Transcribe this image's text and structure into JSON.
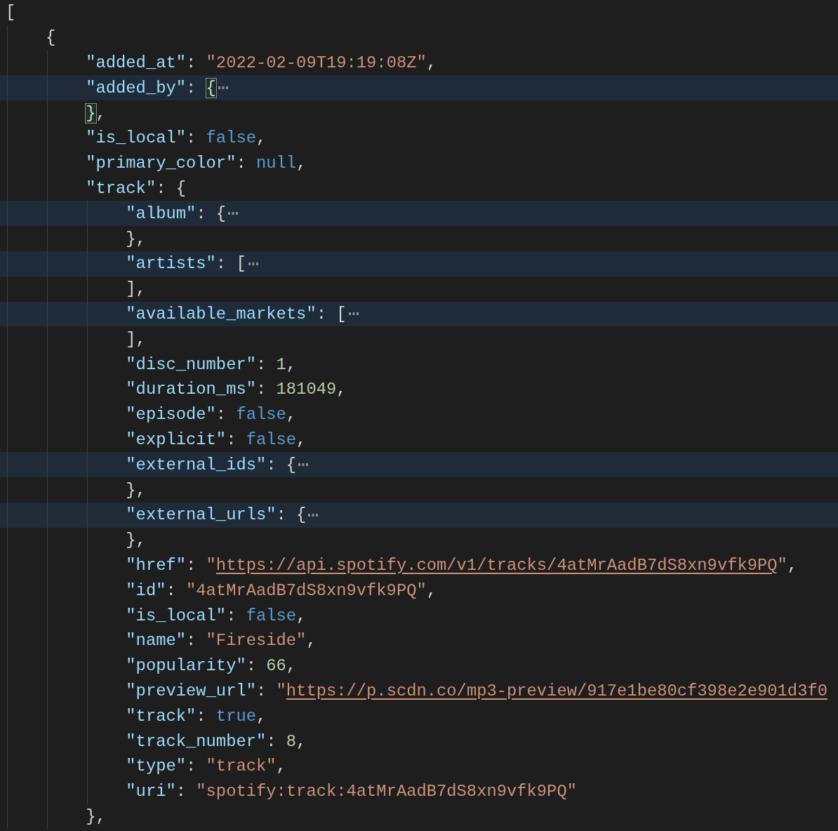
{
  "lines": [
    {
      "folded": false,
      "tokens": [
        {
          "kind": "punct",
          "text": "["
        }
      ],
      "children": [
        {
          "folded": false,
          "tokens": [
            {
              "kind": "punct",
              "text": "{"
            }
          ],
          "children": [
            {
              "folded": false,
              "tokens": [
                {
                  "kind": "key",
                  "text": "\"added_at\""
                },
                {
                  "kind": "punct",
                  "text": ": "
                },
                {
                  "kind": "string",
                  "text": "\"2022-02-09T19:19:08Z\""
                },
                {
                  "kind": "punct",
                  "text": ","
                }
              ]
            },
            {
              "folded": true,
              "tokens": [
                {
                  "kind": "key",
                  "text": "\"added_by\""
                },
                {
                  "kind": "punct",
                  "text": ": "
                },
                {
                  "kind": "match",
                  "text": "{"
                }
              ]
            },
            {
              "folded": false,
              "tokens": [
                {
                  "kind": "match",
                  "text": "}"
                },
                {
                  "kind": "punct",
                  "text": ","
                }
              ]
            },
            {
              "folded": false,
              "tokens": [
                {
                  "kind": "key",
                  "text": "\"is_local\""
                },
                {
                  "kind": "punct",
                  "text": ": "
                },
                {
                  "kind": "keyword",
                  "text": "false"
                },
                {
                  "kind": "punct",
                  "text": ","
                }
              ]
            },
            {
              "folded": false,
              "tokens": [
                {
                  "kind": "key",
                  "text": "\"primary_color\""
                },
                {
                  "kind": "punct",
                  "text": ": "
                },
                {
                  "kind": "keyword",
                  "text": "null"
                },
                {
                  "kind": "punct",
                  "text": ","
                }
              ]
            },
            {
              "folded": false,
              "tokens": [
                {
                  "kind": "key",
                  "text": "\"track\""
                },
                {
                  "kind": "punct",
                  "text": ": {"
                }
              ],
              "children": [
                {
                  "folded": true,
                  "tokens": [
                    {
                      "kind": "key",
                      "text": "\"album\""
                    },
                    {
                      "kind": "punct",
                      "text": ": {"
                    }
                  ]
                },
                {
                  "folded": false,
                  "tokens": [
                    {
                      "kind": "punct",
                      "text": "},"
                    }
                  ]
                },
                {
                  "folded": true,
                  "tokens": [
                    {
                      "kind": "key",
                      "text": "\"artists\""
                    },
                    {
                      "kind": "punct",
                      "text": ": ["
                    }
                  ]
                },
                {
                  "folded": false,
                  "tokens": [
                    {
                      "kind": "punct",
                      "text": "],"
                    }
                  ]
                },
                {
                  "folded": true,
                  "tokens": [
                    {
                      "kind": "key",
                      "text": "\"available_markets\""
                    },
                    {
                      "kind": "punct",
                      "text": ": ["
                    }
                  ]
                },
                {
                  "folded": false,
                  "tokens": [
                    {
                      "kind": "punct",
                      "text": "],"
                    }
                  ]
                },
                {
                  "folded": false,
                  "tokens": [
                    {
                      "kind": "key",
                      "text": "\"disc_number\""
                    },
                    {
                      "kind": "punct",
                      "text": ": "
                    },
                    {
                      "kind": "number",
                      "text": "1"
                    },
                    {
                      "kind": "punct",
                      "text": ","
                    }
                  ]
                },
                {
                  "folded": false,
                  "tokens": [
                    {
                      "kind": "key",
                      "text": "\"duration_ms\""
                    },
                    {
                      "kind": "punct",
                      "text": ": "
                    },
                    {
                      "kind": "number",
                      "text": "181049"
                    },
                    {
                      "kind": "punct",
                      "text": ","
                    }
                  ]
                },
                {
                  "folded": false,
                  "tokens": [
                    {
                      "kind": "key",
                      "text": "\"episode\""
                    },
                    {
                      "kind": "punct",
                      "text": ": "
                    },
                    {
                      "kind": "keyword",
                      "text": "false"
                    },
                    {
                      "kind": "punct",
                      "text": ","
                    }
                  ]
                },
                {
                  "folded": false,
                  "tokens": [
                    {
                      "kind": "key",
                      "text": "\"explicit\""
                    },
                    {
                      "kind": "punct",
                      "text": ": "
                    },
                    {
                      "kind": "keyword",
                      "text": "false"
                    },
                    {
                      "kind": "punct",
                      "text": ","
                    }
                  ]
                },
                {
                  "folded": true,
                  "tokens": [
                    {
                      "kind": "key",
                      "text": "\"external_ids\""
                    },
                    {
                      "kind": "punct",
                      "text": ": {"
                    }
                  ]
                },
                {
                  "folded": false,
                  "tokens": [
                    {
                      "kind": "punct",
                      "text": "},"
                    }
                  ]
                },
                {
                  "folded": true,
                  "tokens": [
                    {
                      "kind": "key",
                      "text": "\"external_urls\""
                    },
                    {
                      "kind": "punct",
                      "text": ": {"
                    }
                  ]
                },
                {
                  "folded": false,
                  "tokens": [
                    {
                      "kind": "punct",
                      "text": "},"
                    }
                  ]
                },
                {
                  "folded": false,
                  "tokens": [
                    {
                      "kind": "key",
                      "text": "\"href\""
                    },
                    {
                      "kind": "punct",
                      "text": ": "
                    },
                    {
                      "kind": "string",
                      "text": "\""
                    },
                    {
                      "kind": "link",
                      "text": "https://api.spotify.com/v1/tracks/4atMrAadB7dS8xn9vfk9PQ"
                    },
                    {
                      "kind": "string",
                      "text": "\""
                    },
                    {
                      "kind": "punct",
                      "text": ","
                    }
                  ]
                },
                {
                  "folded": false,
                  "tokens": [
                    {
                      "kind": "key",
                      "text": "\"id\""
                    },
                    {
                      "kind": "punct",
                      "text": ": "
                    },
                    {
                      "kind": "string",
                      "text": "\"4atMrAadB7dS8xn9vfk9PQ\""
                    },
                    {
                      "kind": "punct",
                      "text": ","
                    }
                  ]
                },
                {
                  "folded": false,
                  "tokens": [
                    {
                      "kind": "key",
                      "text": "\"is_local\""
                    },
                    {
                      "kind": "punct",
                      "text": ": "
                    },
                    {
                      "kind": "keyword",
                      "text": "false"
                    },
                    {
                      "kind": "punct",
                      "text": ","
                    }
                  ]
                },
                {
                  "folded": false,
                  "tokens": [
                    {
                      "kind": "key",
                      "text": "\"name\""
                    },
                    {
                      "kind": "punct",
                      "text": ": "
                    },
                    {
                      "kind": "string",
                      "text": "\"Fireside\""
                    },
                    {
                      "kind": "punct",
                      "text": ","
                    }
                  ]
                },
                {
                  "folded": false,
                  "tokens": [
                    {
                      "kind": "key",
                      "text": "\"popularity\""
                    },
                    {
                      "kind": "punct",
                      "text": ": "
                    },
                    {
                      "kind": "number",
                      "text": "66"
                    },
                    {
                      "kind": "punct",
                      "text": ","
                    }
                  ]
                },
                {
                  "folded": false,
                  "tokens": [
                    {
                      "kind": "key",
                      "text": "\"preview_url\""
                    },
                    {
                      "kind": "punct",
                      "text": ": "
                    },
                    {
                      "kind": "string",
                      "text": "\""
                    },
                    {
                      "kind": "link",
                      "text": "https://p.scdn.co/mp3-preview/917e1be80cf398e2e901d3f0"
                    }
                  ]
                },
                {
                  "folded": false,
                  "tokens": [
                    {
                      "kind": "key",
                      "text": "\"track\""
                    },
                    {
                      "kind": "punct",
                      "text": ": "
                    },
                    {
                      "kind": "keyword",
                      "text": "true"
                    },
                    {
                      "kind": "punct",
                      "text": ","
                    }
                  ]
                },
                {
                  "folded": false,
                  "tokens": [
                    {
                      "kind": "key",
                      "text": "\"track_number\""
                    },
                    {
                      "kind": "punct",
                      "text": ": "
                    },
                    {
                      "kind": "number",
                      "text": "8"
                    },
                    {
                      "kind": "punct",
                      "text": ","
                    }
                  ]
                },
                {
                  "folded": false,
                  "tokens": [
                    {
                      "kind": "key",
                      "text": "\"type\""
                    },
                    {
                      "kind": "punct",
                      "text": ": "
                    },
                    {
                      "kind": "string",
                      "text": "\"track\""
                    },
                    {
                      "kind": "punct",
                      "text": ","
                    }
                  ]
                },
                {
                  "folded": false,
                  "tokens": [
                    {
                      "kind": "key",
                      "text": "\"uri\""
                    },
                    {
                      "kind": "punct",
                      "text": ": "
                    },
                    {
                      "kind": "string",
                      "text": "\"spotify:track:4atMrAadB7dS8xn9vfk9PQ\""
                    }
                  ]
                }
              ]
            },
            {
              "folded": false,
              "tokens": [
                {
                  "kind": "punct",
                  "text": "},"
                }
              ]
            }
          ]
        }
      ]
    }
  ]
}
